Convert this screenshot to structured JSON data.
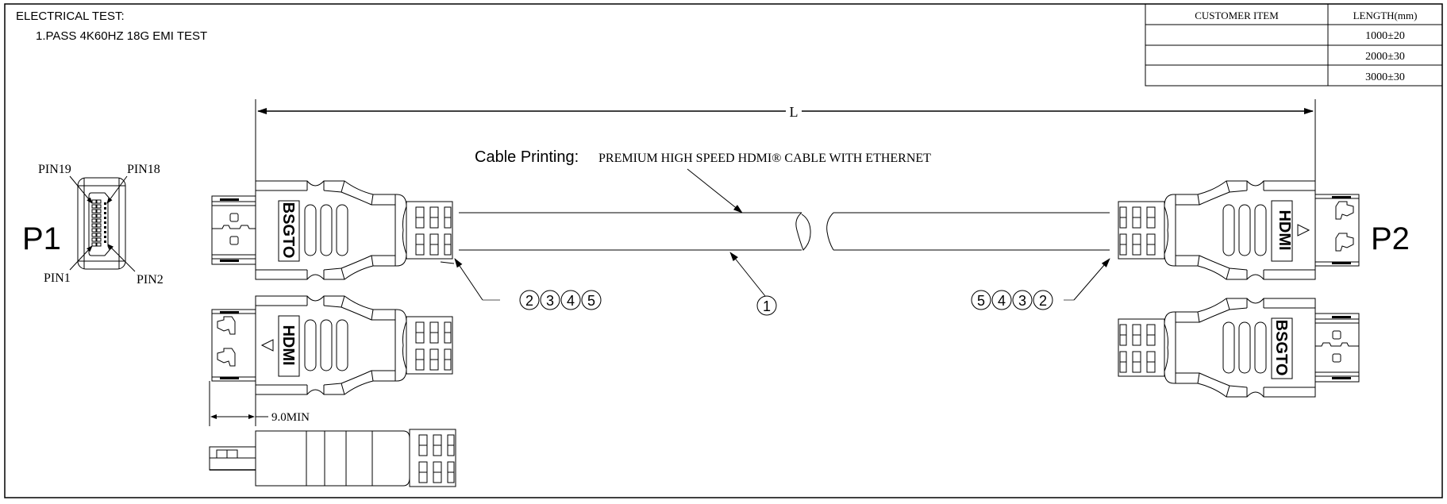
{
  "notes": {
    "title": "ELECTRICAL TEST:",
    "items": [
      "1.PASS 4K60HZ  18G  EMI TEST"
    ]
  },
  "length_table": {
    "headers": [
      "CUSTOMER ITEM",
      "LENGTH(mm)"
    ],
    "rows": [
      {
        "customer_item": "",
        "length": "1000±20"
      },
      {
        "customer_item": "",
        "length": "2000±30"
      },
      {
        "customer_item": "",
        "length": "3000±30"
      }
    ]
  },
  "dimension": {
    "overall_length_label": "L",
    "plug_min_label": "9.0MIN"
  },
  "cable_printing": {
    "label": "Cable Printing:",
    "text": "PREMIUM HIGH SPEED HDMI® CABLE WITH ETHERNET"
  },
  "connectors": {
    "p1_label": "P1",
    "p2_label": "P2",
    "pins": {
      "top_left": "PIN19",
      "top_right": "PIN18",
      "bottom_left": "PIN1",
      "bottom_right": "PIN2"
    },
    "logo_text": "BSGTO",
    "hdmi_logo_text": "HDMI"
  },
  "balloons": {
    "cable": [
      "1"
    ],
    "left_connector": [
      "2",
      "3",
      "4",
      "5"
    ],
    "right_connector": [
      "5",
      "4",
      "3",
      "2"
    ]
  }
}
